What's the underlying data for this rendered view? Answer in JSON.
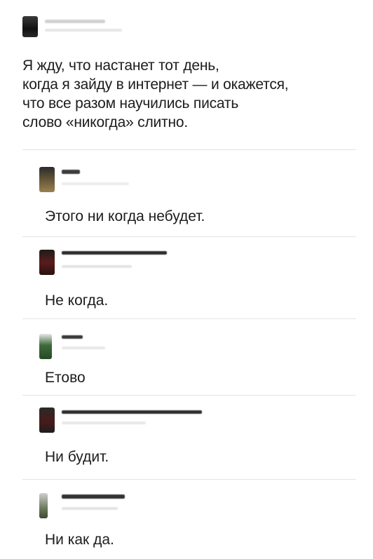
{
  "post": {
    "lines": [
      "Я жду, что настанет тот день,",
      "когда я зайду в интернет — и окажется,",
      "что все разом научились писать",
      "слово «никогда» слитно."
    ]
  },
  "comments": [
    {
      "text": "Этого ни когда небудет."
    },
    {
      "text": "Не когда."
    },
    {
      "text": "Етово"
    },
    {
      "text": "Ни будит."
    },
    {
      "text": "Ни как да."
    }
  ],
  "colors": {
    "text": "#1c1c1c",
    "divider": "#e4e4e4",
    "background": "#ffffff"
  },
  "icons": {
    "post_avatar": "avatar-photo",
    "comment_avatars": [
      "avatar-photo",
      "avatar-photo",
      "avatar-photo",
      "avatar-photo",
      "avatar-photo"
    ]
  }
}
